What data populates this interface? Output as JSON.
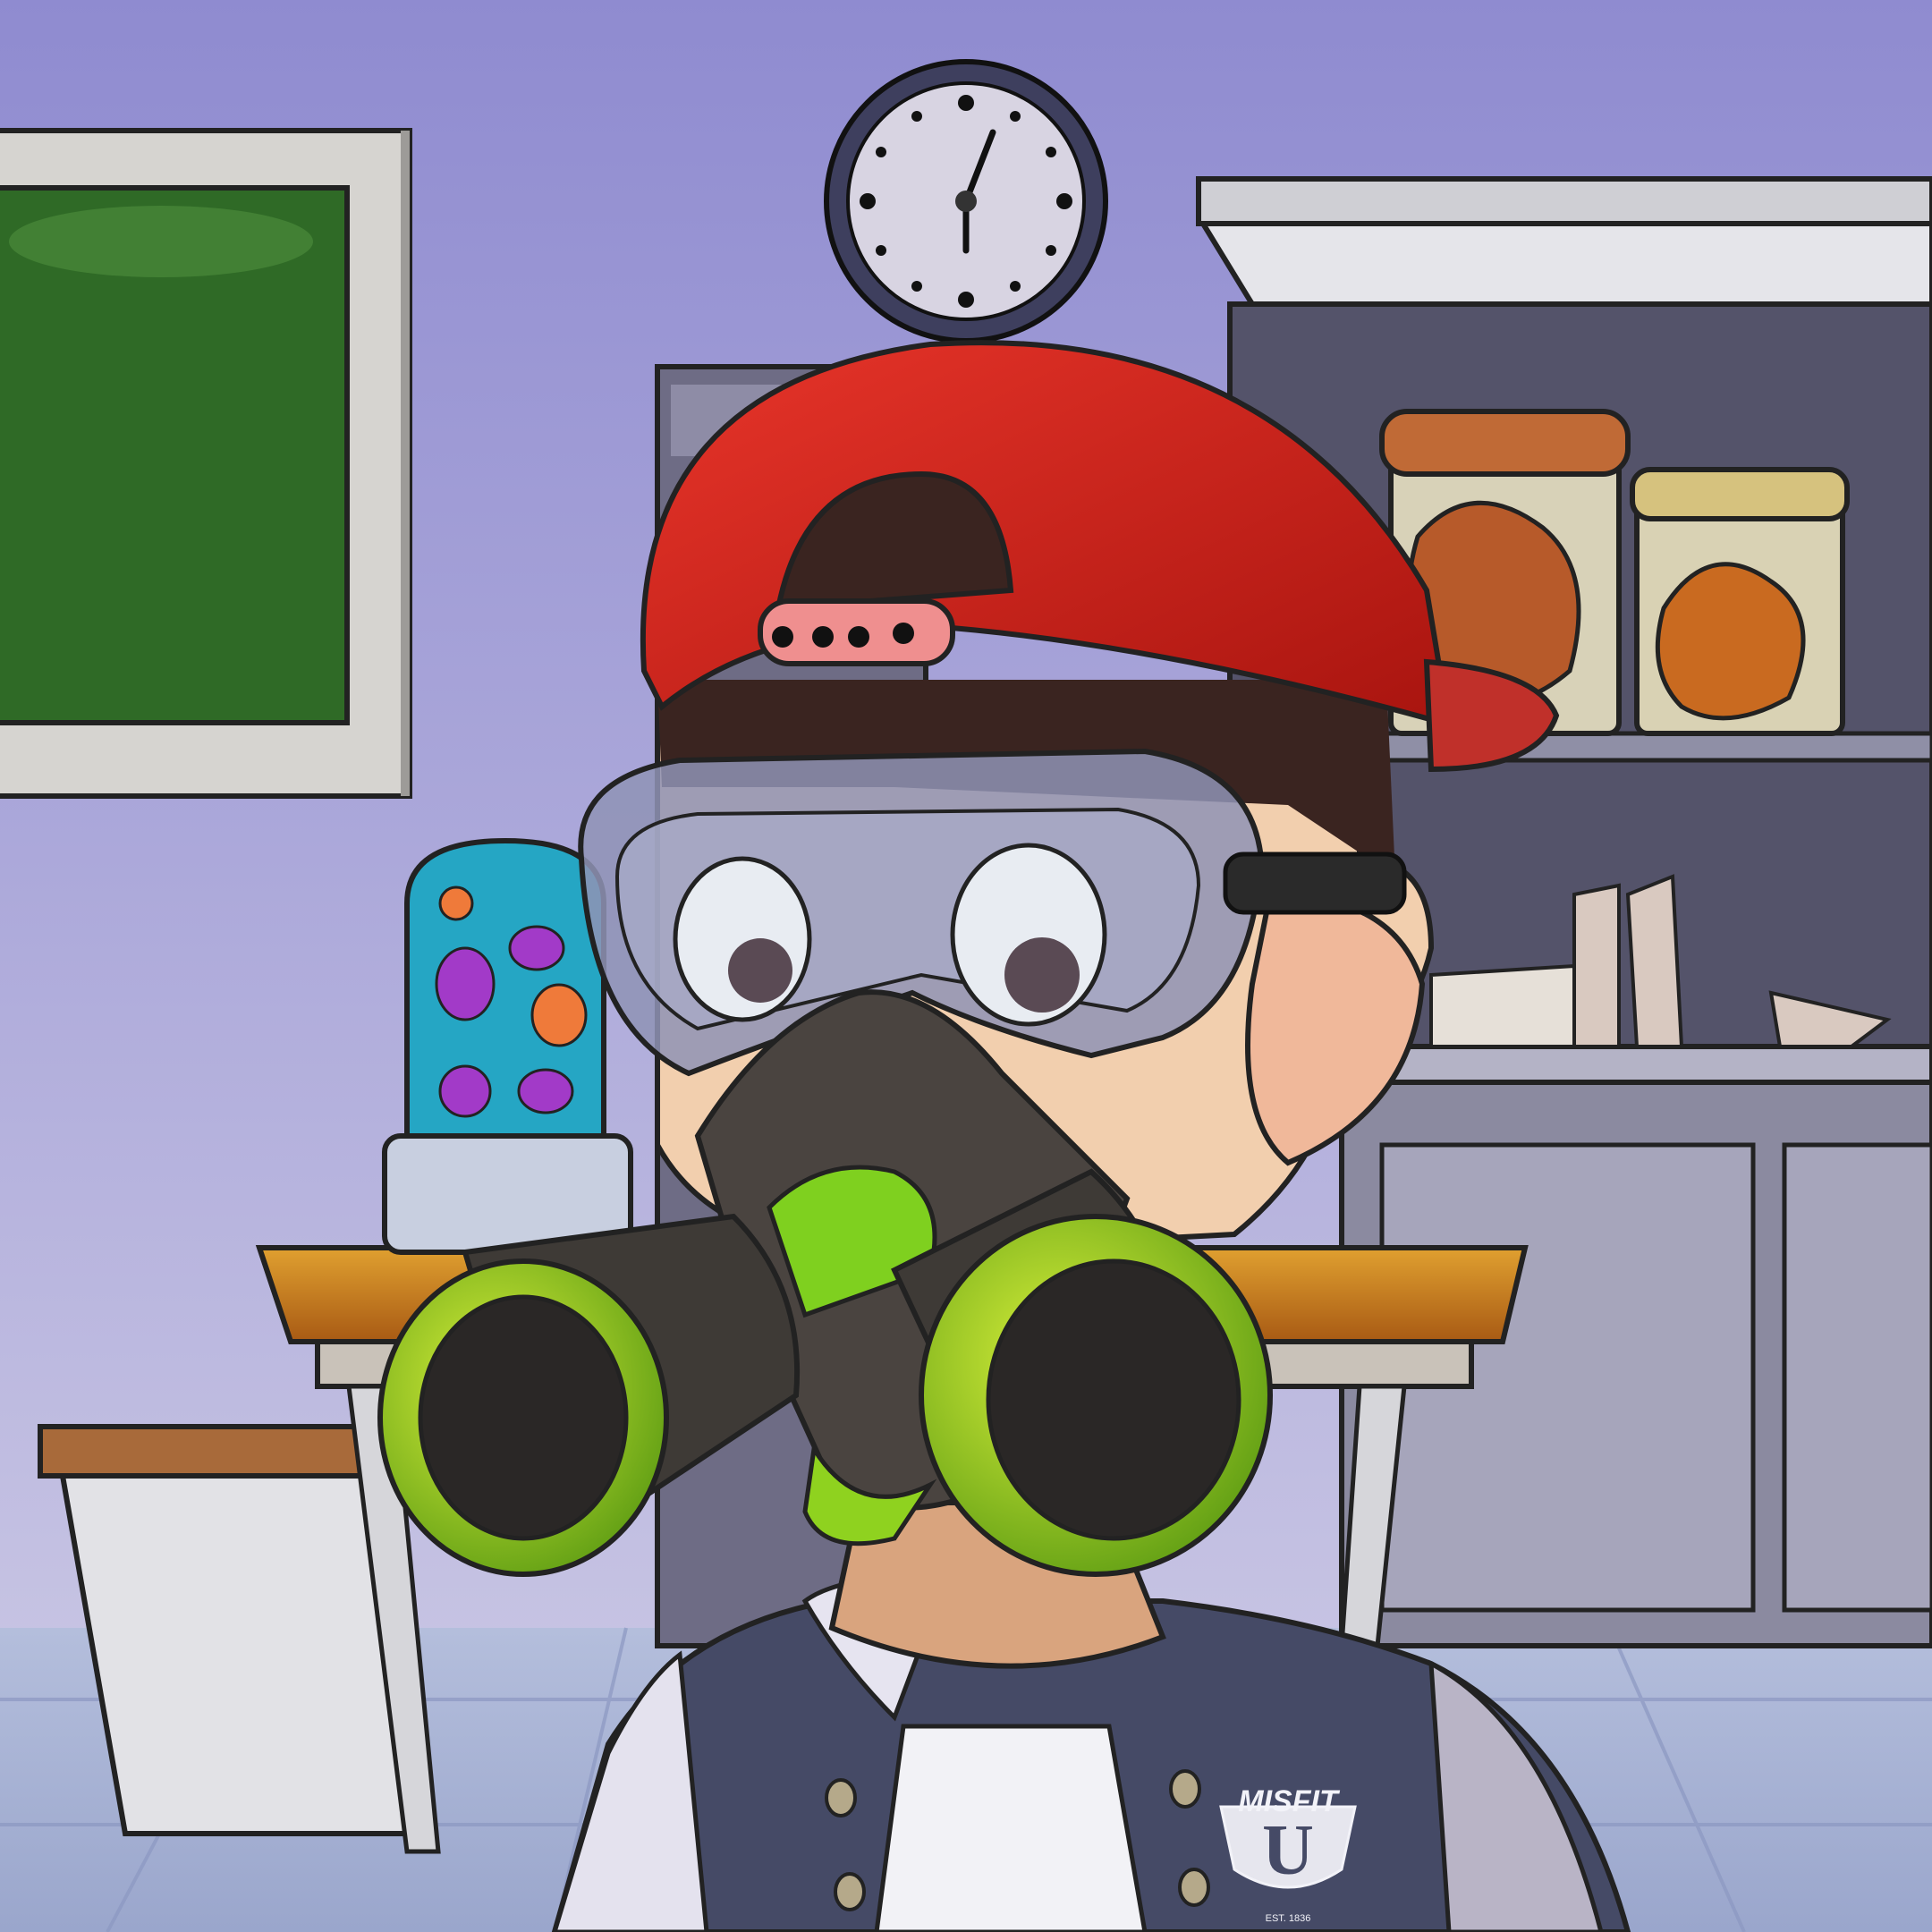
{
  "scene": {
    "description_free": true,
    "colors": {
      "wall_top": "#8f8bd0",
      "wall_bottom": "#c2bfe0",
      "cap_red": "#d7261f",
      "mask_green": "#8fd21f",
      "jacket_navy": "#454a66",
      "chalkboard_green": "#2f6a26"
    },
    "icons": [
      "clock-icon",
      "chalkboard",
      "lava-lamp",
      "specimen-jar",
      "gas-mask",
      "goggles",
      "baseball-cap",
      "varsity-jacket"
    ]
  },
  "logo": {
    "top": "MISFIT",
    "letter": "U",
    "est": "EST. 1836"
  }
}
